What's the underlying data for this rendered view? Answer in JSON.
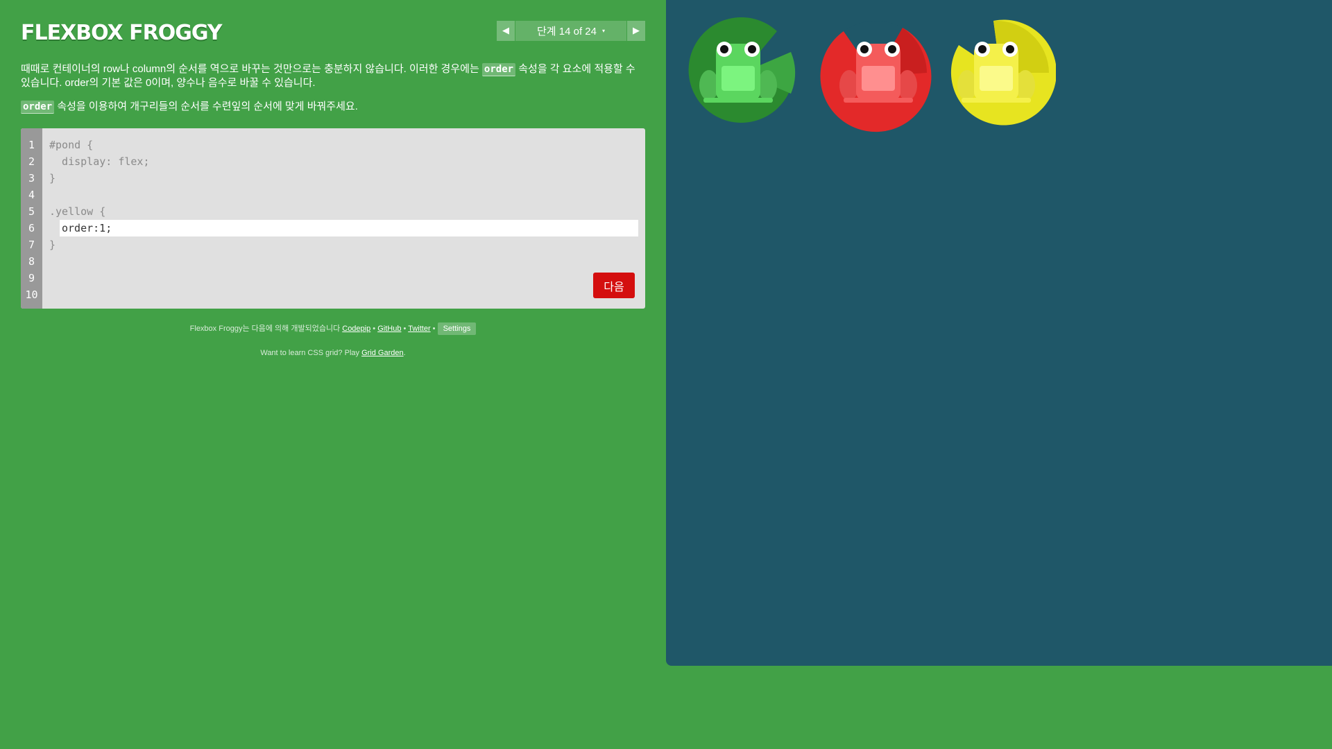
{
  "app": {
    "logo": "FLEXBOX FROGGY"
  },
  "level_nav": {
    "prev_icon": "◀",
    "next_icon": "▶",
    "level_text": "단계 14 of 24",
    "caret": "▾"
  },
  "instructions": {
    "p1_before": "때때로 컨테이너의 row나 column의 순서를 역으로 바꾸는 것만으로는 충분하지 않습니다. 이러한 경우에는 ",
    "p1_code": "order",
    "p1_after": " 속성을 각 요소에 적용할 수 있습니다. order의 기본 값은 0이며, 양수나 음수로 바꿀 수 있습니다.",
    "p2_code": "order",
    "p2_after": " 속성을 이용하여 개구리들의 순서를 수련잎의 순서에 맞게 바꿔주세요."
  },
  "editor": {
    "line_numbers": [
      "1",
      "2",
      "3",
      "4",
      "5",
      "6",
      "7",
      "8",
      "9",
      "10"
    ],
    "lines": [
      "#pond {",
      "  display: flex;",
      "}",
      "",
      ".yellow {"
    ],
    "input_value": "order:1;",
    "closing_line": "}",
    "next_label": "다음"
  },
  "footer": {
    "credits_prefix": "Flexbox Froggy는 다음에 의해 개발되었습니다 ",
    "codepip": "Codepip",
    "sep": " • ",
    "github": "GitHub",
    "twitter": "Twitter",
    "settings": "Settings",
    "grid_prefix": "Want to learn CSS grid? Play ",
    "grid_link": "Grid Garden",
    "grid_suffix": "."
  },
  "pond": {
    "lilypads": [
      {
        "name": "green",
        "color": "#2b8a2f",
        "frog_color": "#5bd65f",
        "belly": "#7cf47f"
      },
      {
        "name": "red",
        "color": "#e32929",
        "frog_color": "#f45b5b",
        "belly": "#ff8f8f"
      },
      {
        "name": "yellow",
        "color": "#e7e420",
        "frog_color": "#f4f04a",
        "belly": "#fbfa8a"
      }
    ],
    "background": "#1f5768"
  },
  "colors": {
    "page_bg": "#42a147",
    "next_button": "#d40e0e",
    "editor_bg": "#e0e0e0"
  }
}
